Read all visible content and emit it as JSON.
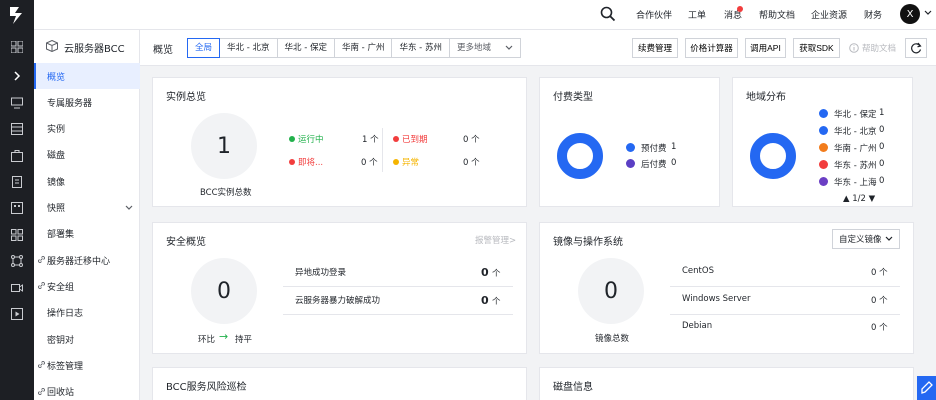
{
  "header": {
    "nav": [
      "合作伙伴",
      "工单",
      "消息",
      "帮助文档",
      "企业资源",
      "财务"
    ],
    "avatar_letter": "X"
  },
  "sidebar": {
    "title": "云服务器BCC",
    "items": [
      {
        "label": "概览",
        "active": true,
        "link": false,
        "expand": false
      },
      {
        "label": "专属服务器",
        "active": false,
        "link": false,
        "expand": false
      },
      {
        "label": "实例",
        "active": false,
        "link": false,
        "expand": false
      },
      {
        "label": "磁盘",
        "active": false,
        "link": false,
        "expand": false
      },
      {
        "label": "镜像",
        "active": false,
        "link": false,
        "expand": false
      },
      {
        "label": "快照",
        "active": false,
        "link": false,
        "expand": true
      },
      {
        "label": "部署集",
        "active": false,
        "link": false,
        "expand": false
      },
      {
        "label": "服务器迁移中心",
        "active": false,
        "link": true,
        "expand": false
      },
      {
        "label": "安全组",
        "active": false,
        "link": true,
        "expand": false
      },
      {
        "label": "操作日志",
        "active": false,
        "link": false,
        "expand": false
      },
      {
        "label": "密钥对",
        "active": false,
        "link": false,
        "expand": false
      },
      {
        "label": "标签管理",
        "active": false,
        "link": true,
        "expand": false
      },
      {
        "label": "回收站",
        "active": false,
        "link": true,
        "expand": false
      }
    ]
  },
  "toolbar": {
    "title": "概览",
    "regions": [
      "全局",
      "华北 - 北京",
      "华北 - 保定",
      "华南 - 广州",
      "华东 - 苏州"
    ],
    "more_regions": "更多地域",
    "buttons": [
      "续费管理",
      "价格计算器",
      "调用API",
      "获取SDK"
    ],
    "help": "帮助文档"
  },
  "instance_overview": {
    "title": "实例总览",
    "total": "1",
    "total_label": "BCC实例总数",
    "statuses": [
      {
        "label": "运行中",
        "value": "1 个",
        "color": "#22b14c"
      },
      {
        "label": "已到期",
        "value": "0 个",
        "color": "#f23d3d"
      },
      {
        "label": "即将...",
        "value": "0 个",
        "color": "#f23d3d"
      },
      {
        "label": "异常",
        "value": "0 个",
        "color": "#f5b400"
      }
    ]
  },
  "payment_type": {
    "title": "付费类型",
    "legend": [
      {
        "label": "预付费",
        "value": "1",
        "color": "#2468f2"
      },
      {
        "label": "后付费",
        "value": "0",
        "color": "#5b3fc4"
      }
    ]
  },
  "region_distribution": {
    "title": "地域分布",
    "legend": [
      {
        "label": "华北 - 保定",
        "value": "1",
        "color": "#2468f2"
      },
      {
        "label": "华北 - 北京",
        "value": "0",
        "color": "#2468f2"
      },
      {
        "label": "华南 - 广州",
        "value": "0",
        "color": "#f27c1c"
      },
      {
        "label": "华东 - 苏州",
        "value": "0",
        "color": "#f23d3d"
      },
      {
        "label": "华东 - 上海",
        "value": "0",
        "color": "#6b3fc4"
      }
    ],
    "pager": "1/2"
  },
  "security_overview": {
    "title": "安全概览",
    "link": "报警管理>",
    "total": "0",
    "trend_label": "环比",
    "trend_value": "持平",
    "rows": [
      {
        "label": "异地成功登录",
        "count": "0",
        "unit": "个"
      },
      {
        "label": "云服务器暴力破解成功",
        "count": "0",
        "unit": "个"
      }
    ]
  },
  "images_os": {
    "title": "镜像与操作系统",
    "select": "自定义镜像",
    "total": "0",
    "total_label": "镜像总数",
    "rows": [
      {
        "label": "CentOS",
        "value": "0 个"
      },
      {
        "label": "Windows Server",
        "value": "0 个"
      },
      {
        "label": "Debian",
        "value": "0 个"
      }
    ]
  },
  "risk_inspection": {
    "title": "BCC服务风险巡检"
  },
  "disk_info": {
    "title": "磁盘信息"
  }
}
